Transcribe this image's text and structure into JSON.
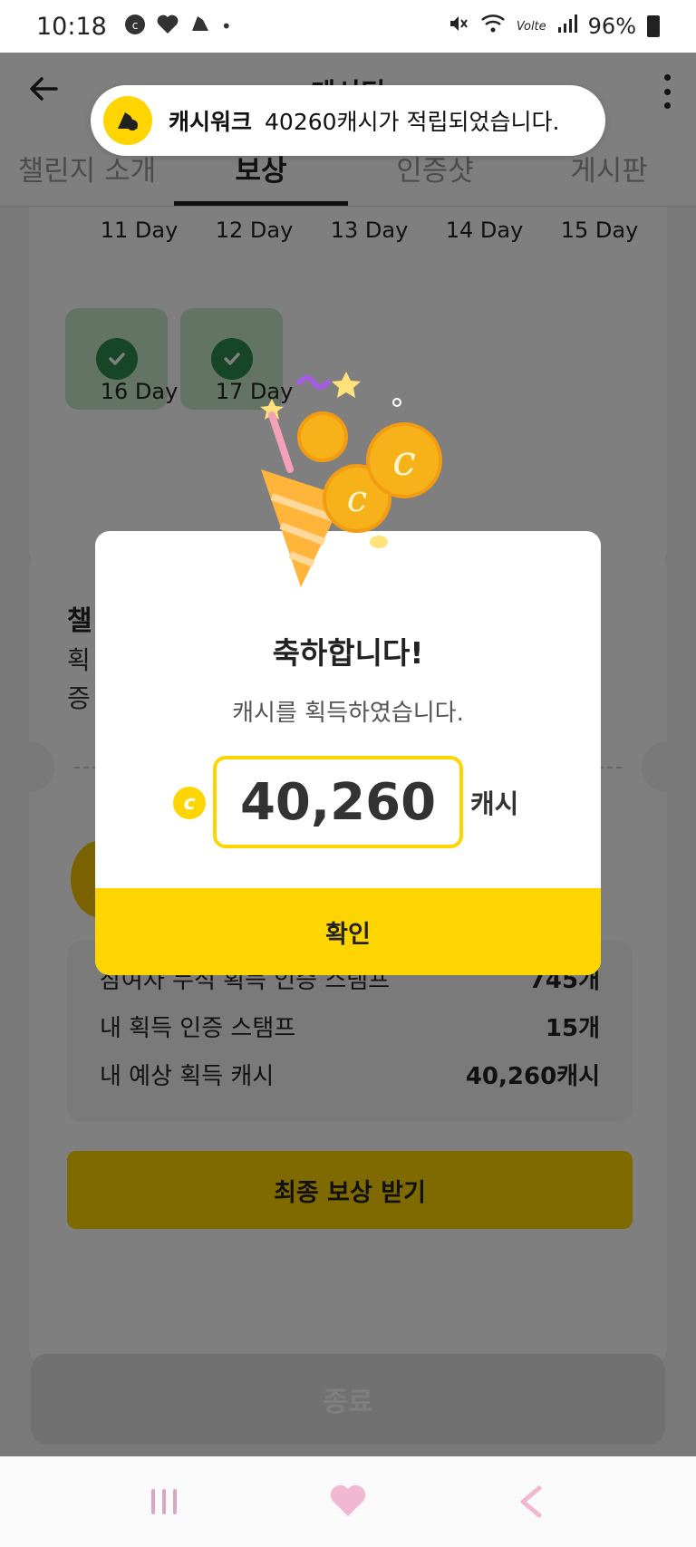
{
  "status_bar": {
    "time": "10:18",
    "notif_dot": "•",
    "network_label": "Volte",
    "battery": "96%"
  },
  "header": {
    "title": "게시티"
  },
  "tabs": [
    {
      "label": "챌린지 소개",
      "active": false
    },
    {
      "label": "보상",
      "active": true
    },
    {
      "label": "인증샷",
      "active": false
    },
    {
      "label": "게시판",
      "active": false
    }
  ],
  "days": {
    "row1": [
      "11 Day",
      "12 Day",
      "13 Day",
      "14 Day",
      "15 Day"
    ],
    "row2": [
      "16 Day",
      "17 Day"
    ]
  },
  "challenge": {
    "title": "챌",
    "desc_line1": "획",
    "desc_line2": "증"
  },
  "stats": [
    {
      "label": "참여자 누적 획득 인증 스탬프",
      "value": "745개"
    },
    {
      "label": "내 획득 인증 스탬프",
      "value": "15개"
    },
    {
      "label": "내 예상 획득 캐시",
      "value": "40,260캐시"
    }
  ],
  "final_reward_button": "최종 보상 받기",
  "end_button": "종료",
  "toast": {
    "app_name": "캐시워크",
    "message": "40260캐시가 적립되었습니다."
  },
  "modal": {
    "title": "축하합니다!",
    "subtitle": "캐시를 획득하였습니다.",
    "coin_glyph": "c",
    "amount": "40,260",
    "unit": "캐시",
    "confirm": "확인"
  },
  "colors": {
    "accent_yellow": "#ffd500",
    "check_green": "#2e8b4e"
  }
}
